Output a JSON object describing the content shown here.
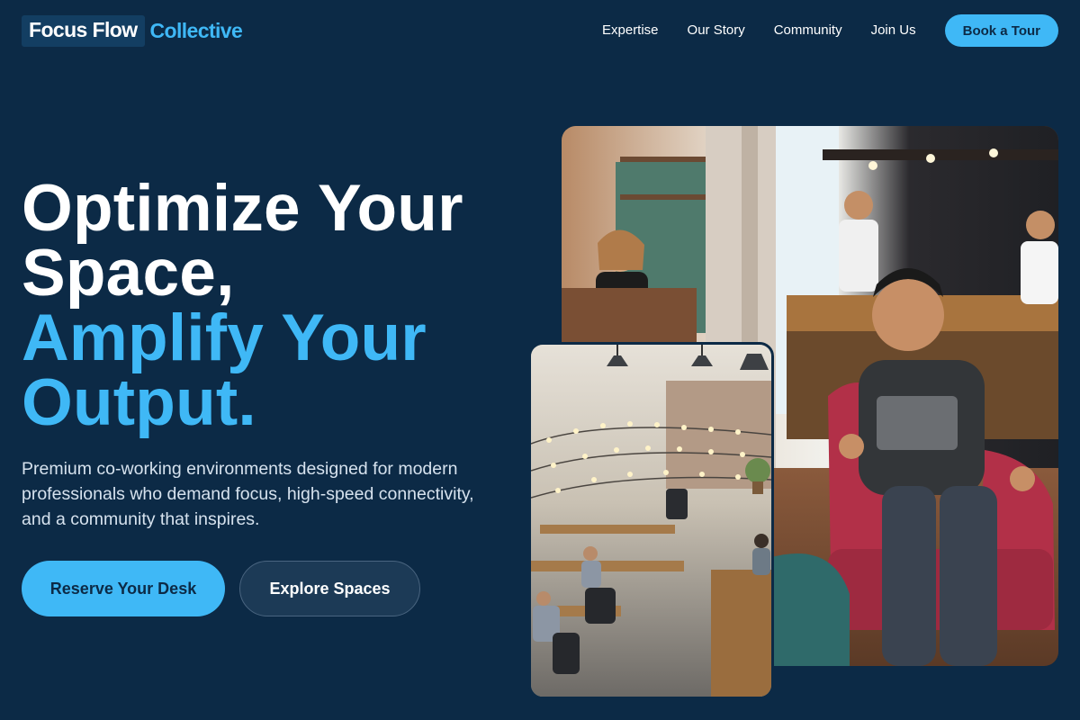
{
  "brand": {
    "name_primary": "Focus Flow",
    "name_accent": "Collective"
  },
  "nav": {
    "links": [
      "Expertise",
      "Our Story",
      "Community",
      "Join Us"
    ],
    "cta": "Book a Tour"
  },
  "hero": {
    "title_lines": [
      "Optimize Your",
      "Space,"
    ],
    "title_accent_lines": [
      "Amplify Your",
      "Output."
    ],
    "description": "Premium co-working environments designed for modern professionals who demand focus, high-speed connectivity, and a community that inspires.",
    "primary_button": "Reserve Your Desk",
    "secondary_button": "Explore Spaces"
  },
  "images": {
    "main": "cafe-workspace-photo",
    "secondary": "open-office-photo"
  },
  "colors": {
    "background": "#0c2a46",
    "accent": "#3fb8f6",
    "logo_box": "#133e62",
    "secondary_button": "#1c3a56"
  }
}
